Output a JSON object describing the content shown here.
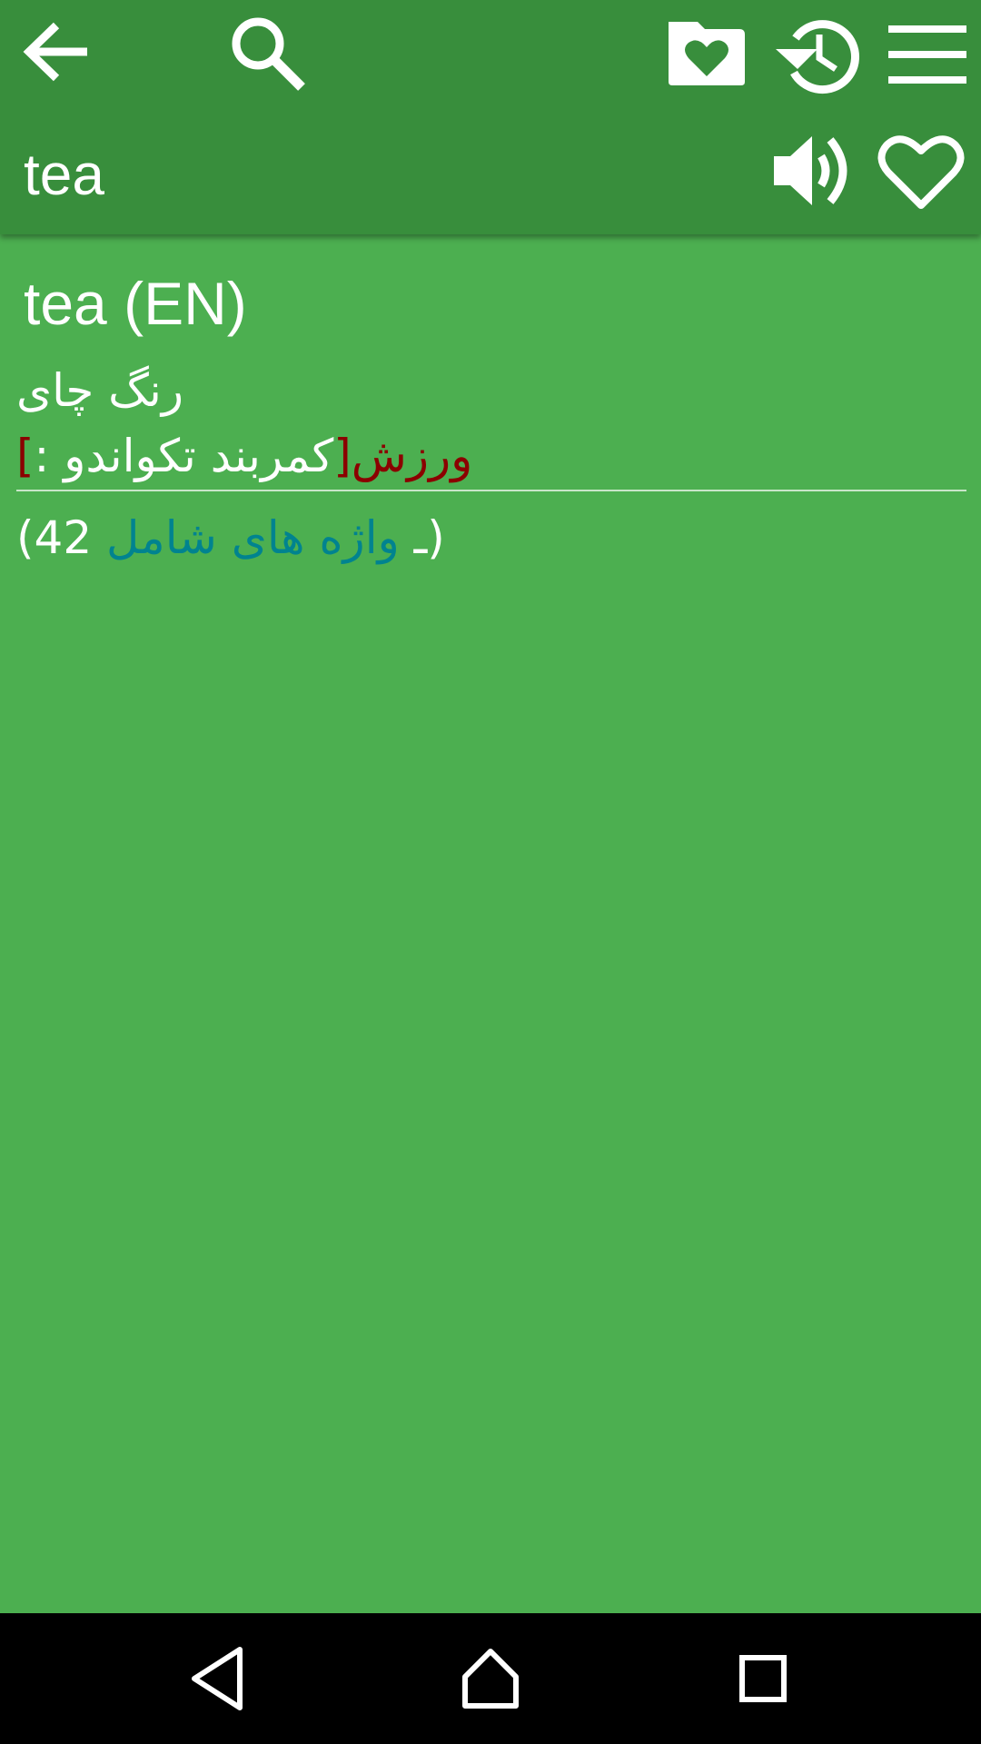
{
  "toolbar": {
    "back_icon": "arrow-left-icon",
    "search_icon": "search-icon",
    "favorites_folder_icon": "folder-heart-icon",
    "history_icon": "history-icon",
    "menu_icon": "menu-icon",
    "speak_icon": "speaker-icon",
    "favorite_icon": "heart-outline-icon"
  },
  "search": {
    "word": "tea"
  },
  "entry": {
    "title": "tea (EN)",
    "definitions": [
      {
        "text": "رنگ چای"
      },
      {
        "open_bracket": "[",
        "category": "ورزش",
        "close_bracket": "]",
        "text": ": کمربند تکواندو"
      }
    ],
    "related": {
      "open_paren": "(",
      "link_text": "واژه های شامل",
      "separator": " ـ ",
      "count_text": "(42",
      "close_paren": ")"
    }
  },
  "navbar": {
    "back_icon": "nav-back-icon",
    "home_icon": "nav-home-icon",
    "recent_icon": "nav-recent-apps-icon"
  },
  "colors": {
    "toolbar_bg": "#388e3c",
    "content_bg": "#4caf50",
    "category_color": "#8b0000",
    "link_color": "#00838f",
    "navbar_bg": "#000000"
  }
}
